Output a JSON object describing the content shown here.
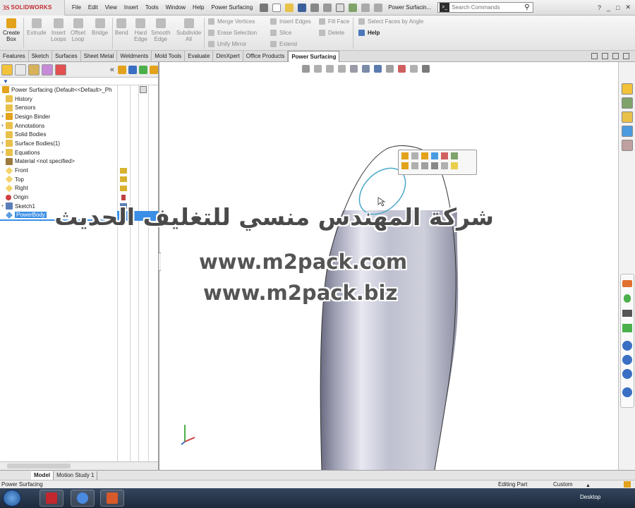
{
  "app": {
    "brand": "SOLIDWORKS",
    "document_title": "Power Surfacin...",
    "search_placeholder": "Search Commands"
  },
  "menu": [
    "File",
    "Edit",
    "View",
    "Insert",
    "Tools",
    "Window",
    "Help",
    "Power Surfacing"
  ],
  "commands": {
    "create_box": [
      "Create",
      "Box"
    ],
    "extrude": "Extrude",
    "insert_loops": [
      "Insert",
      "Loops"
    ],
    "offset_loop": [
      "Offset",
      "Loop"
    ],
    "bridge": "Bridge",
    "bend": "Bend",
    "hard_edge": [
      "Hard",
      "Edge"
    ],
    "smooth_edge": [
      "Smooth",
      "Edge"
    ],
    "subdivide_all": [
      "Subdivide",
      "All"
    ],
    "merge_vertices": "Merge Vertices",
    "erase_selection": "Erase Selection",
    "unify_mirror": "Unify Mirror",
    "insert_edges": "Insert Edges",
    "slice": "Slice",
    "extend": "Extend",
    "fill_face": "Fill Face",
    "delete": "Delete",
    "select_faces_by_angle": "Select Faces by Angle",
    "help": "Help"
  },
  "tabs": [
    "Features",
    "Sketch",
    "Surfaces",
    "Sheet Metal",
    "Weldments",
    "Mold Tools",
    "Evaluate",
    "DimXpert",
    "Office Products",
    "Power Surfacing"
  ],
  "active_tab": "Power Surfacing",
  "feature_tree": {
    "root": "Power Surfacing  (Default<<Default>_Ph",
    "items": [
      {
        "label": "History",
        "expandable": false,
        "icon": "history-folder-icon"
      },
      {
        "label": "Sensors",
        "expandable": false,
        "icon": "sensors-folder-icon"
      },
      {
        "label": "Design Binder",
        "expandable": true,
        "icon": "design-binder-icon"
      },
      {
        "label": "Annotations",
        "expandable": true,
        "icon": "annotations-icon"
      },
      {
        "label": "Solid Bodies",
        "expandable": false,
        "icon": "solid-bodies-icon"
      },
      {
        "label": "Surface Bodies(1)",
        "expandable": true,
        "icon": "surface-bodies-icon"
      },
      {
        "label": "Equations",
        "expandable": true,
        "icon": "equations-icon"
      },
      {
        "label": "Material <not specified>",
        "expandable": false,
        "icon": "material-icon"
      },
      {
        "label": "Front",
        "expandable": false,
        "icon": "plane-icon"
      },
      {
        "label": "Top",
        "expandable": false,
        "icon": "plane-icon"
      },
      {
        "label": "Right",
        "expandable": false,
        "icon": "plane-icon"
      },
      {
        "label": "Origin",
        "expandable": false,
        "icon": "origin-icon"
      },
      {
        "label": "Sketch1",
        "expandable": true,
        "icon": "sketch-icon"
      },
      {
        "label": "PowerBody",
        "expandable": false,
        "icon": "power-body-icon",
        "selected": true
      }
    ]
  },
  "watermark": {
    "arabic": "شركة المهندس منسي للتغليف الحديث",
    "url1": "www.m2pack.com",
    "url2": "www.m2pack.biz"
  },
  "bottom_tabs": [
    "Model",
    "Motion Study 1"
  ],
  "status": {
    "left": "Power Surfacing",
    "mode": "Editing Part",
    "units": "Custom"
  },
  "taskbar": {
    "desktop": "Desktop"
  },
  "colors": {
    "accent_yellow": "#e2a21b",
    "selection_blue": "#3a8ee6",
    "brand_red": "#c1272d",
    "body_gray": "#b7b7c6"
  }
}
